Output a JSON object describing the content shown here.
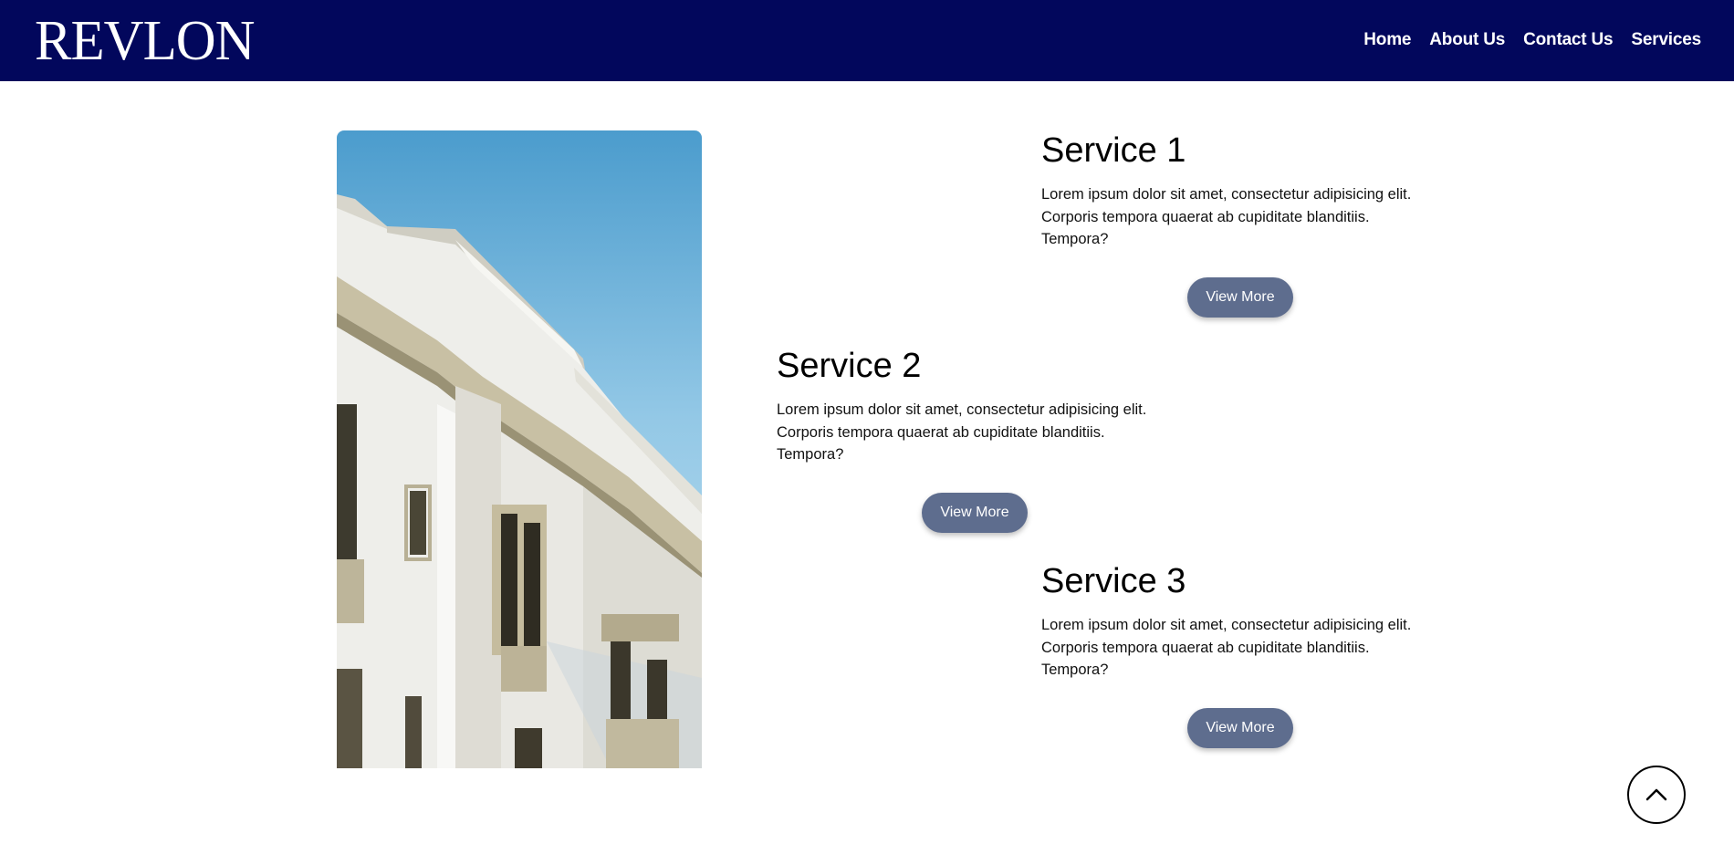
{
  "header": {
    "logo_text": "REVLON",
    "nav": [
      {
        "label": "Home"
      },
      {
        "label": "About Us"
      },
      {
        "label": "Contact Us"
      },
      {
        "label": "Services"
      }
    ]
  },
  "services": [
    {
      "title": "Service 1",
      "text": "Lorem ipsum dolor sit amet, consectetur adipisicing elit. Corporis tempora quaerat ab cupiditate blanditiis. Tempora?",
      "button_label": "View More"
    },
    {
      "title": "Service 2",
      "text": "Lorem ipsum dolor sit amet, consectetur adipisicing elit. Corporis tempora quaerat ab cupiditate blanditiis. Tempora?",
      "button_label": "View More"
    },
    {
      "title": "Service 3",
      "text": "Lorem ipsum dolor sit amet, consectetur adipisicing elit. Corporis tempora quaerat ab cupiditate blanditiis. Tempora?",
      "button_label": "View More"
    }
  ],
  "colors": {
    "navbar": "#02075c",
    "button": "#5e6d8e"
  },
  "icons": {
    "scroll_top": "chevron-up-icon"
  }
}
